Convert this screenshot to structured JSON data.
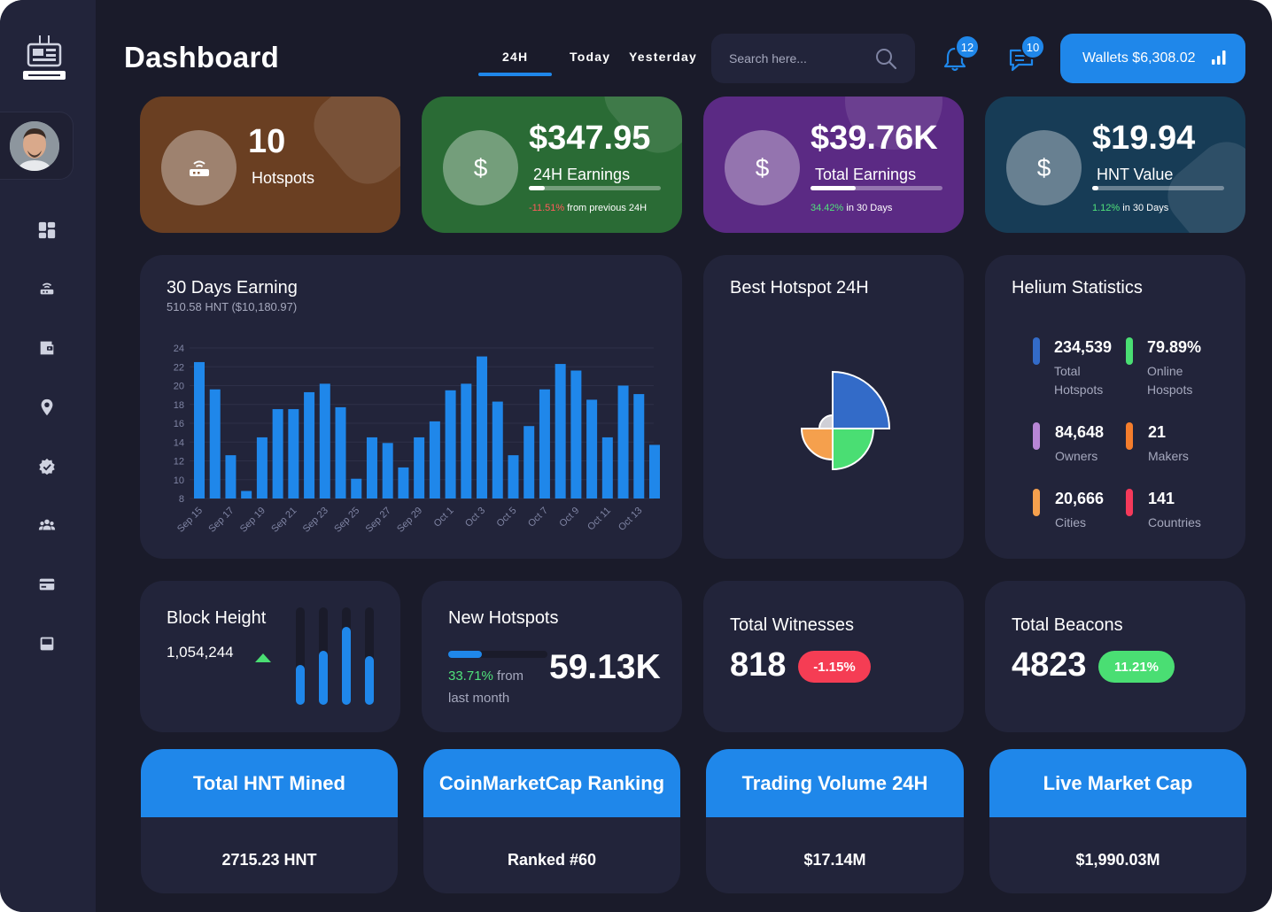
{
  "header": {
    "title": "Dashboard",
    "tabs": [
      "24H",
      "Today",
      "Yesterday"
    ],
    "active_tab": "24H",
    "search_placeholder": "Search here...",
    "notifications_count": "12",
    "messages_count": "10",
    "wallet_label": "Wallets $6,308.02"
  },
  "sidebar": {
    "items": [
      "dashboard",
      "hotspots",
      "wallet",
      "location",
      "badges",
      "users",
      "payments",
      "archive"
    ]
  },
  "stats": {
    "hotspots": {
      "value": "10",
      "label": "Hotspots",
      "color": "#6a3f22"
    },
    "earnings24": {
      "value": "$347.95",
      "label": "24H Earnings",
      "change": "-11.51%",
      "change_text": "from previous 24H",
      "progress": 0.12,
      "color": "#2a6b35"
    },
    "total_earnings": {
      "value": "$39.76K",
      "label": "Total Earnings",
      "change": "34.42%",
      "change_text": "in 30 Days",
      "progress": 0.34,
      "color": "#5b2a84"
    },
    "hnt_value": {
      "value": "$19.94",
      "label": "HNT Value",
      "change": "1.12%",
      "change_text": "in 30 Days",
      "progress": 0.05,
      "color": "#173c56"
    }
  },
  "earning_chart": {
    "title": "30 Days Earning",
    "subtitle": "510.58 HNT ($10,180.97)"
  },
  "chart_data": {
    "type": "bar",
    "title": "30 Days Earning",
    "ylim": [
      8,
      24
    ],
    "yticks": [
      8,
      10,
      12,
      14,
      16,
      18,
      20,
      22,
      24
    ],
    "tick_labels": [
      "Sep 15",
      "Sep 17",
      "Sep 19",
      "Sep 21",
      "Sep 23",
      "Sep 25",
      "Sep 27",
      "Sep 29",
      "Oct 1",
      "Oct 3",
      "Oct 5",
      "Oct 7",
      "Oct 9",
      "Oct 11",
      "Oct 13"
    ],
    "values": [
      22.5,
      19.6,
      12.6,
      8.8,
      14.5,
      17.5,
      17.5,
      19.3,
      20.2,
      17.7,
      10.1,
      14.5,
      13.9,
      11.3,
      14.5,
      16.2,
      19.5,
      20.2,
      23.1,
      18.3,
      12.6,
      15.7,
      19.6,
      22.3,
      21.6,
      18.5,
      14.5,
      20.0,
      19.1,
      13.7
    ],
    "grid": true,
    "color": "#1f87ea"
  },
  "best_hotspot": {
    "title": "Best Hotspot 24H",
    "slices": [
      {
        "label": "",
        "color": "#336bc8"
      },
      {
        "label": "",
        "color": "#4ade73"
      },
      {
        "label": "",
        "color": "#f5a04d"
      },
      {
        "label": "",
        "color": "#cfcfd6"
      }
    ]
  },
  "helium": {
    "title": "Helium Statistics",
    "items": [
      {
        "value": "234,539",
        "label": "Total Hotspots",
        "color": "#336bc8"
      },
      {
        "value": "79.89%",
        "label": "Online Hospots",
        "color": "#4ade73"
      },
      {
        "value": "84,648",
        "label": "Owners",
        "color": "#b886d6"
      },
      {
        "value": "21",
        "label": "Makers",
        "color": "#f57d2c"
      },
      {
        "value": "20,666",
        "label": "Cities",
        "color": "#f5a04d"
      },
      {
        "value": "141",
        "label": "Countries",
        "color": "#f5395a"
      }
    ]
  },
  "block_height": {
    "title": "Block Height",
    "value": "1,054,244",
    "bar_levels": [
      0.41,
      0.55,
      0.8,
      0.5
    ]
  },
  "new_hotspots": {
    "title": "New Hotspots",
    "value": "59.13K",
    "change": "33.71%",
    "change_text": "from",
    "change_text2": "last month",
    "progress": 0.34
  },
  "witnesses": {
    "title": "Total Witnesses",
    "value": "818",
    "change": "-1.15%",
    "color": "#f53d54"
  },
  "beacons": {
    "title": "Total Beacons",
    "value": "4823",
    "change": "11.21%",
    "color": "#4ade73"
  },
  "mined": [
    {
      "title": "Total HNT Mined",
      "value": "2715.23 HNT"
    },
    {
      "title": "CoinMarketCap Ranking",
      "value": "Ranked #60"
    },
    {
      "title": "Trading Volume 24H",
      "value": "$17.14M"
    },
    {
      "title": "Live Market Cap",
      "value": "$1,990.03M"
    }
  ]
}
